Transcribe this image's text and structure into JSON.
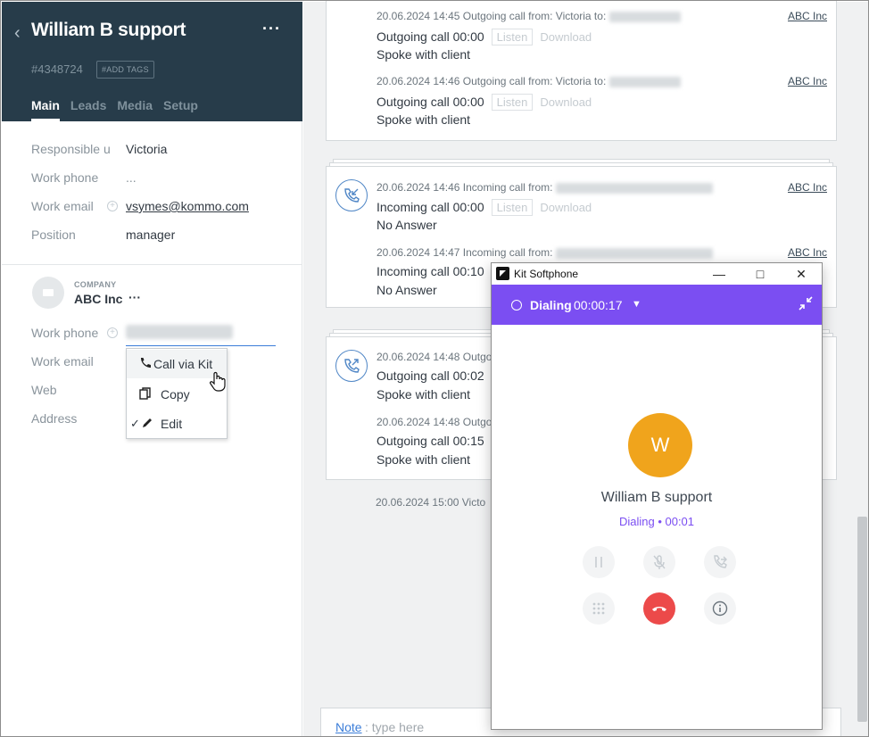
{
  "contact": {
    "name": "William B support",
    "id": "#4348724",
    "add_tags": "#ADD TAGS",
    "more": "···",
    "tabs": [
      "Main",
      "Leads",
      "Media",
      "Setup"
    ]
  },
  "fields": {
    "responsible_label": "Responsible u",
    "responsible_value": "Victoria",
    "work_phone_label": "Work phone",
    "work_phone_value": "...",
    "work_email_label": "Work email",
    "work_email_value": "vsymes@kommo.com",
    "position_label": "Position",
    "position_value": "manager"
  },
  "company": {
    "label": "COMPANY",
    "name": "ABC Inc",
    "more": "···",
    "work_phone_label": "Work phone",
    "work_email_label": "Work email",
    "web_label": "Web",
    "address_label": "Address"
  },
  "context_menu": {
    "call": "Call via Kit",
    "copy": "Copy",
    "edit": "Edit"
  },
  "feed": {
    "company_link": "ABC Inc",
    "listen": "Listen",
    "download": "Download",
    "entries": [
      {
        "meta": "20.06.2024 14:45 Outgoing call from: Victoria to:",
        "line": "Outgoing call 00:00",
        "status": "Spoke with client"
      },
      {
        "meta": "20.06.2024 14:46 Outgoing call from: Victoria to:",
        "line": "Outgoing call 00:00",
        "status": "Spoke with client"
      },
      {
        "meta": "20.06.2024 14:46 Incoming call from:",
        "line": "Incoming call 00:00",
        "status": "No Answer"
      },
      {
        "meta": "20.06.2024 14:47 Incoming call from:",
        "line": "Incoming call 00:10",
        "status": "No Answer"
      },
      {
        "meta": "20.06.2024 14:48 Outgo",
        "line": "Outgoing call 00:02",
        "status": "Spoke with client"
      },
      {
        "meta": "20.06.2024 14:48 Outgo",
        "line": "Outgoing call 00:15",
        "status": "Spoke with client"
      },
      {
        "meta": "20.06.2024 15:00 Victo"
      }
    ],
    "note_label": "Note",
    "note_placeholder": ": type here"
  },
  "softphone": {
    "window_title": "Kit Softphone",
    "state": "Dialing",
    "timer": "00:00:17",
    "avatar_letter": "W",
    "callee": "William B support",
    "call_status": "Dialing • 00:01",
    "accent_color": "#7b4ef2",
    "avatar_color": "#f0a41c",
    "hangup_color": "#ec4a4a"
  }
}
